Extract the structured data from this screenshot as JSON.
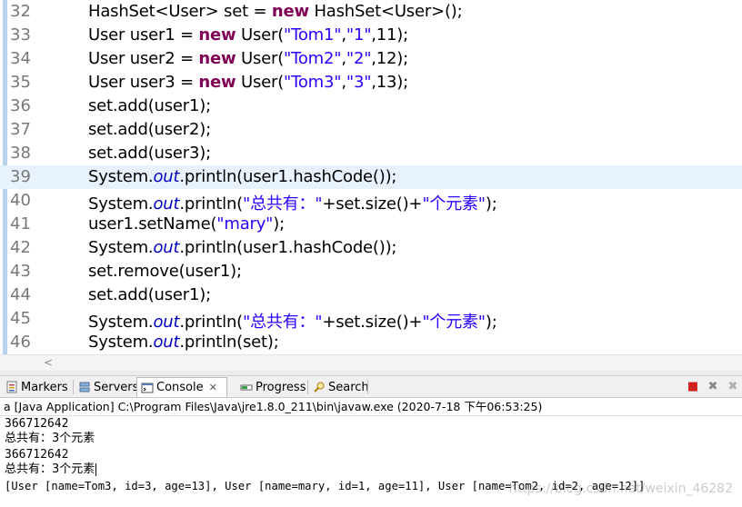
{
  "editor": {
    "current_line": "39",
    "lines": [
      {
        "num": "32",
        "tokens": [
          [
            "n",
            "HashSet<User> set = "
          ],
          [
            "k",
            "new"
          ],
          [
            "n",
            " HashSet<User>();"
          ]
        ]
      },
      {
        "num": "33",
        "tokens": [
          [
            "n",
            "User user1 = "
          ],
          [
            "k",
            "new"
          ],
          [
            "n",
            " User("
          ],
          [
            "s",
            "\"Tom1\""
          ],
          [
            "n",
            ","
          ],
          [
            "s",
            "\"1\""
          ],
          [
            "n",
            ",11);"
          ]
        ]
      },
      {
        "num": "34",
        "tokens": [
          [
            "n",
            "User user2 = "
          ],
          [
            "k",
            "new"
          ],
          [
            "n",
            " User("
          ],
          [
            "s",
            "\"Tom2\""
          ],
          [
            "n",
            ","
          ],
          [
            "s",
            "\"2\""
          ],
          [
            "n",
            ",12);"
          ]
        ]
      },
      {
        "num": "35",
        "tokens": [
          [
            "n",
            "User user3 = "
          ],
          [
            "k",
            "new"
          ],
          [
            "n",
            " User("
          ],
          [
            "s",
            "\"Tom3\""
          ],
          [
            "n",
            ","
          ],
          [
            "s",
            "\"3\""
          ],
          [
            "n",
            ",13);"
          ]
        ]
      },
      {
        "num": "36",
        "tokens": [
          [
            "n",
            "set.add(user1);"
          ]
        ]
      },
      {
        "num": "37",
        "tokens": [
          [
            "n",
            "set.add(user2);"
          ]
        ]
      },
      {
        "num": "38",
        "tokens": [
          [
            "n",
            "set.add(user3);"
          ]
        ]
      },
      {
        "num": "39",
        "tokens": [
          [
            "n",
            "System."
          ],
          [
            "f",
            "out"
          ],
          [
            "n",
            ".println(user1.hashCode());"
          ]
        ]
      },
      {
        "num": "40",
        "tokens": [
          [
            "n",
            "System."
          ],
          [
            "f",
            "out"
          ],
          [
            "n",
            ".println("
          ],
          [
            "s",
            "\"总共有：\""
          ],
          [
            "n",
            "+set.size()+"
          ],
          [
            "s",
            "\"个元素\""
          ],
          [
            "n",
            ");"
          ]
        ]
      },
      {
        "num": "41",
        "tokens": [
          [
            "n",
            "user1.setName("
          ],
          [
            "s",
            "\"mary\""
          ],
          [
            "n",
            ");"
          ]
        ]
      },
      {
        "num": "42",
        "tokens": [
          [
            "n",
            "System."
          ],
          [
            "f",
            "out"
          ],
          [
            "n",
            ".println(user1.hashCode());"
          ]
        ]
      },
      {
        "num": "43",
        "tokens": [
          [
            "n",
            "set.remove(user1);"
          ]
        ]
      },
      {
        "num": "44",
        "tokens": [
          [
            "n",
            "set.add(user1);"
          ]
        ]
      },
      {
        "num": "45",
        "tokens": [
          [
            "n",
            "System."
          ],
          [
            "f",
            "out"
          ],
          [
            "n",
            ".println("
          ],
          [
            "s",
            "\"总共有：\""
          ],
          [
            "n",
            "+set.size()+"
          ],
          [
            "s",
            "\"个元素\""
          ],
          [
            "n",
            ");"
          ]
        ]
      },
      {
        "num": "46",
        "tokens": [
          [
            "n",
            "System."
          ],
          [
            "f",
            "out"
          ],
          [
            "n",
            ".println(set);"
          ]
        ]
      }
    ],
    "colors": {
      "keyword": "#7f0055",
      "string": "#2a00ff",
      "field": "#0000c0",
      "current_line_bg": "#e8f2fe"
    }
  },
  "tabs": {
    "markers": "Markers",
    "servers": "Servers",
    "console": "Console",
    "console_close": "✕",
    "progress": "Progress",
    "search": "Search"
  },
  "toolbar": {
    "terminate": "■",
    "remove": "✖",
    "remove_all": "✖"
  },
  "launch_info": "a [Java Application] C:\\Program Files\\Java\\jre1.8.0_211\\bin\\javaw.exe (2020-7-18 下午06:53:25)",
  "console_output": [
    "366712642",
    "总共有：3个元素",
    "366712642",
    "总共有：3个元素",
    "[User [name=Tom3, id=3, age=13], User [name=mary, id=1, age=11], User [name=Tom2, id=2, age=12]]"
  ],
  "watermark": "https://blog.csdn.net/weixin_46282"
}
